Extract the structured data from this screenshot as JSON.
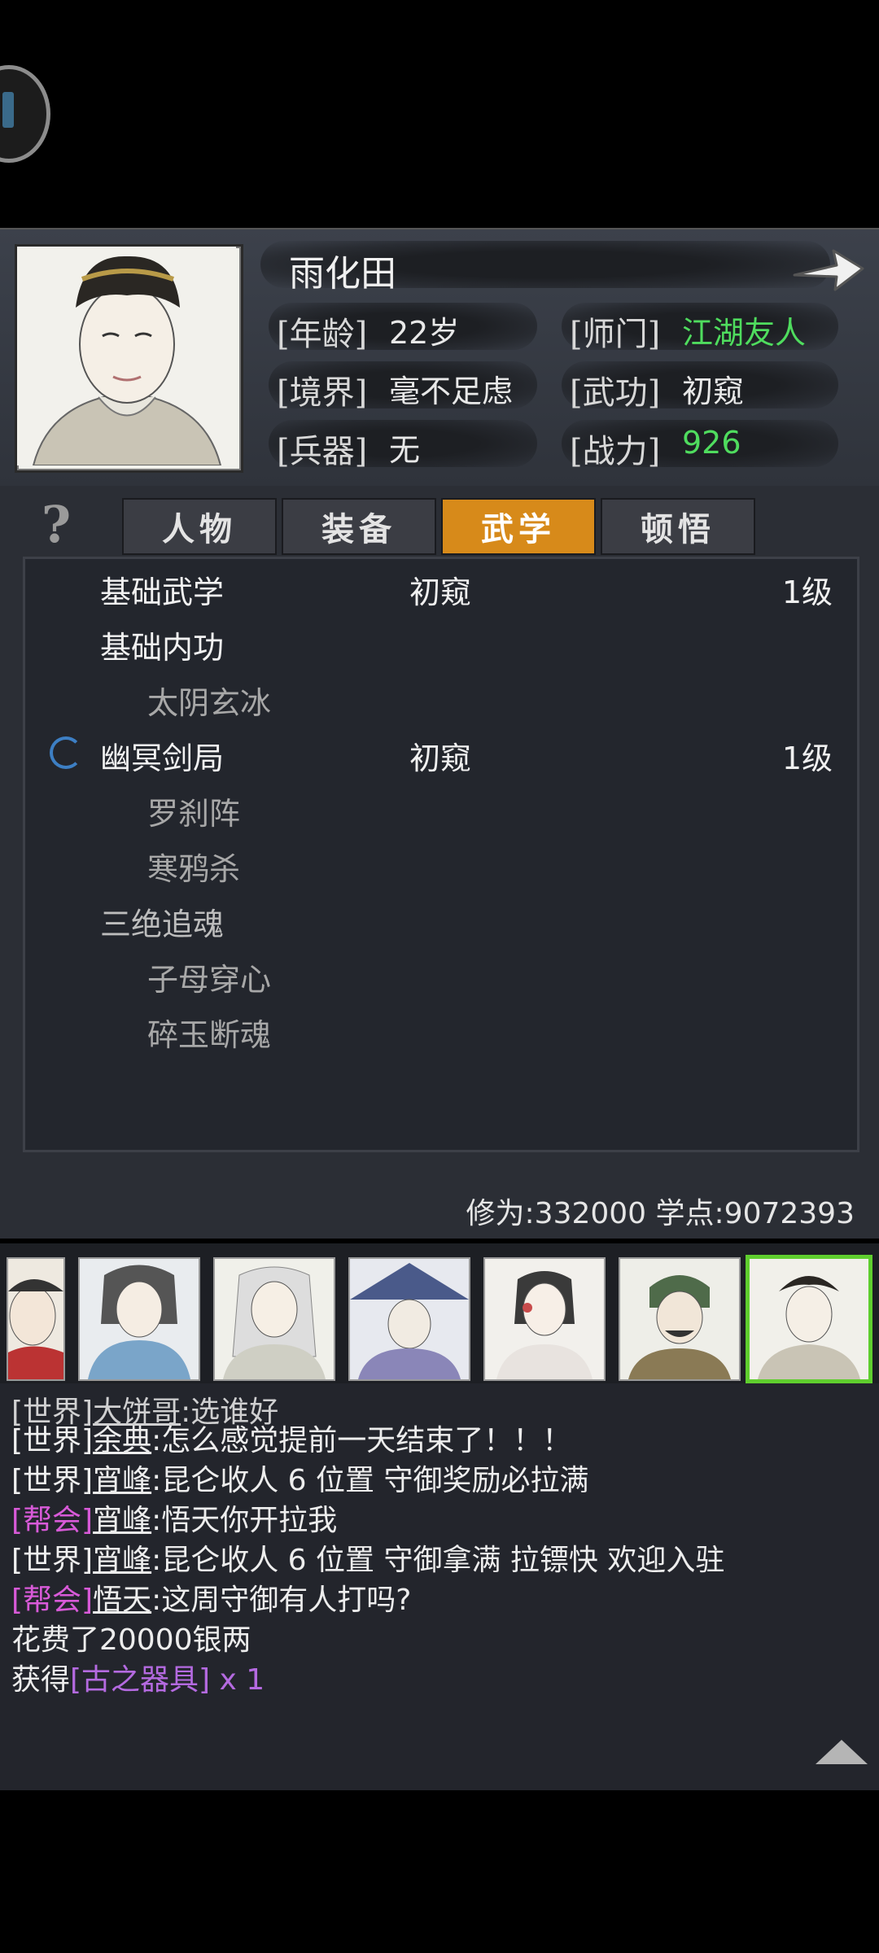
{
  "profile": {
    "name": "雨化田",
    "age_label": "[年龄]",
    "age": "22岁",
    "school_label": "[师门]",
    "school": "江湖友人",
    "realm_label": "[境界]",
    "realm": "毫不足虑",
    "martial_label": "[武功]",
    "martial": "初窥",
    "weapon_label": "[兵器]",
    "weapon": "无",
    "power_label": "[战力]",
    "power": "926",
    "accent_green": "#4fdc5e"
  },
  "tabs": [
    {
      "label": "人物",
      "active": false
    },
    {
      "label": "装备",
      "active": false
    },
    {
      "label": "武学",
      "active": true
    },
    {
      "label": "顿悟",
      "active": false
    }
  ],
  "help_label": "?",
  "skills": [
    {
      "name": "基础武学",
      "rank": "初窥",
      "level": "1级"
    },
    {
      "name": "基础内功",
      "rank": "",
      "level": ""
    },
    {
      "name": "太阴玄冰",
      "rank": "",
      "level": ""
    },
    {
      "name": "幽冥剑局",
      "rank": "初窥",
      "level": "1级"
    },
    {
      "name": "罗刹阵",
      "rank": "",
      "level": ""
    },
    {
      "name": "寒鸦杀",
      "rank": "",
      "level": ""
    },
    {
      "name": "三绝追魂",
      "rank": "",
      "level": ""
    },
    {
      "name": "子母穿心",
      "rank": "",
      "level": ""
    },
    {
      "name": "碎玉断魂",
      "rank": "",
      "level": ""
    }
  ],
  "stats": "修为:332000  学点:9072393",
  "chat": [
    {
      "channel": "[世界]",
      "who": "大饼哥",
      "msg": ":选谁好"
    },
    {
      "channel": "[世界]",
      "who": "余典",
      "msg": ":怎么感觉提前一天结束了！！！"
    },
    {
      "channel": "[世界]",
      "who": "宵峰",
      "msg": ":昆仑收人 6 位置 守御奖励必拉满"
    },
    {
      "channel": "[帮会]",
      "who": "宵峰",
      "msg": ":悟天你开拉我"
    },
    {
      "channel": "[世界]",
      "who": "宵峰",
      "msg": ":昆仑收人 6 位置 守御拿满 拉镖快 欢迎入驻"
    },
    {
      "channel": "[帮会]",
      "who": "悟天",
      "msg": ":这周守御有人打吗?"
    }
  ],
  "system": {
    "spend": "花费了20000银两",
    "gain_prefix": "获得",
    "gain_item": "[古之器具]",
    "gain_count": " x 1"
  }
}
